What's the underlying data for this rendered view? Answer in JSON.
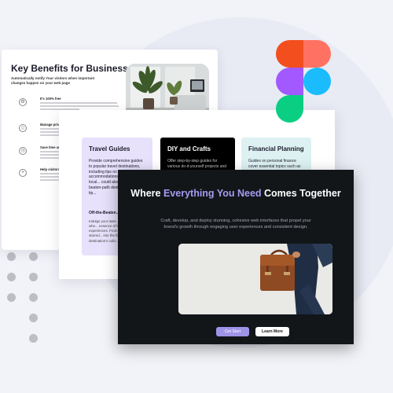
{
  "card_benefits": {
    "title": "Key Benefits for Business",
    "subtitle": "Automatically notify Your visitors when important changes happen on your web page",
    "features": [
      {
        "title": "It's 100% free",
        "icon": "gear-icon"
      },
      {
        "title": "Manage privacy",
        "icon": "shield-icon"
      },
      {
        "title": "Save time and m",
        "icon": "clock-icon"
      },
      {
        "title": "Help visitors to s",
        "icon": "user-icon"
      }
    ]
  },
  "card_guides": {
    "tiles": [
      {
        "title": "Travel Guides",
        "body": "Provide comprehensive guides to popular travel destinations, including tips on accommodations, dining, and local... could also include beaten-path dest... budget travel tip...",
        "sub": "Off-the-Beaten...",
        "body2": "Indulge your taste... travel guides, whe... essence of local cu... experiences. From ... to Michelin-starred... into the flavors ... destination's culin..."
      },
      {
        "title": "DIY and Crafts",
        "body": "Offer step-by-step guides for various do-it-yourself projects and crafts. This can include any condition"
      },
      {
        "title": "Financial Planning",
        "body": "Guides on personal finance cover essential topics such as budgeting, saving, investing, and"
      }
    ]
  },
  "card_hero": {
    "title_part1": "Where ",
    "title_highlight": "Everything You Need",
    "title_part2": " Comes Together",
    "text": "Craft, develop, and deploy stunning, cohesive web interfaces that propel your brand's growth through engaging user experiences and consistent design.",
    "primary_button": "Get Start",
    "secondary_button": "Learn More"
  },
  "colors": {
    "accent": "#a79af2",
    "travel_tile": "#e7e1fb",
    "diy_tile": "#000000",
    "finance_tile": "#ddf1f3",
    "hero_bg": "#121619",
    "figma_red": "#f24e1e",
    "figma_coral": "#ff7262",
    "figma_purple": "#a259ff",
    "figma_blue": "#1abcfe",
    "figma_green": "#0acf83"
  }
}
